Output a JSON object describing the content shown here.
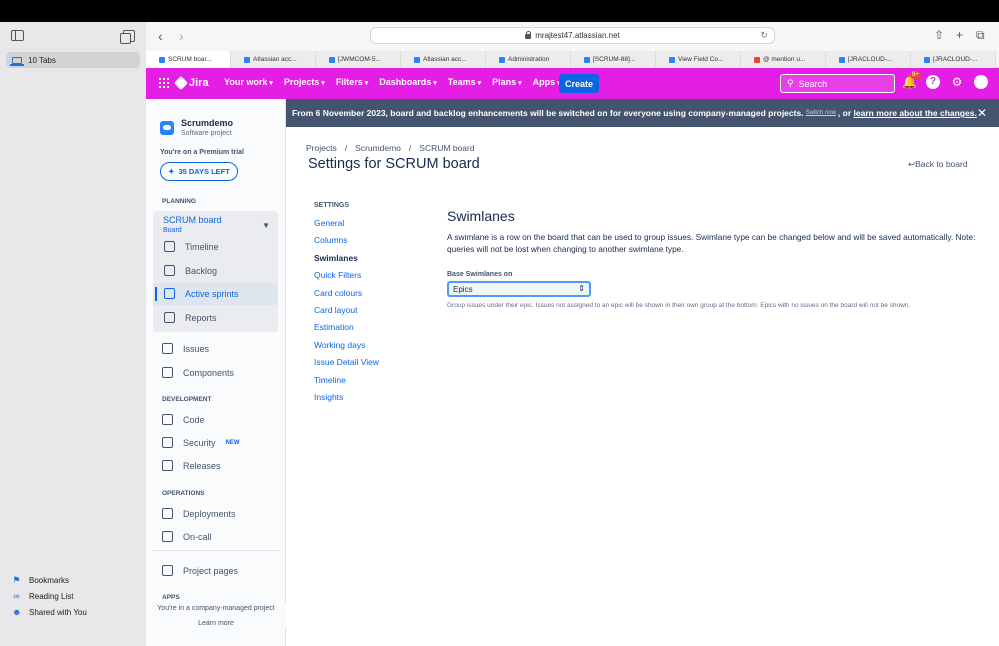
{
  "browser": {
    "sidebar": {
      "tab_group_label": "10 Tabs",
      "links": [
        {
          "label": "Bookmarks",
          "icon": "bookmark-icon"
        },
        {
          "label": "Reading List",
          "icon": "glasses-icon"
        },
        {
          "label": "Shared with You",
          "icon": "people-icon"
        }
      ]
    },
    "url": "mrajtest47.atlassian.net",
    "tabs": [
      {
        "label": "SCRUM boar...",
        "color": "#2684ff"
      },
      {
        "label": "Atlassian acc...",
        "color": "#2684ff"
      },
      {
        "label": "[JWMCOM-5...",
        "color": "#2684ff"
      },
      {
        "label": "Atlassian acc...",
        "color": "#2684ff"
      },
      {
        "label": "Administration",
        "color": "#2684ff"
      },
      {
        "label": "[SCRUM-88]...",
        "color": "#2684ff"
      },
      {
        "label": "View Field Co...",
        "color": "#2684ff"
      },
      {
        "label": "@ mention u...",
        "color": "#ea4335"
      },
      {
        "label": "[JRACLOUD-...",
        "color": "#2684ff"
      },
      {
        "label": "[JRACLOUD-...",
        "color": "#2684ff"
      }
    ]
  },
  "jira": {
    "logo": "Jira",
    "menu": [
      "Your work",
      "Projects",
      "Filters",
      "Dashboards",
      "Teams",
      "Plans",
      "Apps"
    ],
    "create_label": "Create",
    "search_placeholder": "Search",
    "notif_badge": "9+",
    "accent": "#e41ee4"
  },
  "project_sidebar": {
    "name": "Scrumdemo",
    "type": "Software project",
    "trial_text": "You're on a Premium trial",
    "trial_button": "35 DAYS LEFT",
    "planning_label": "PLANNING",
    "board_name": "SCRUM board",
    "board_sub": "Board",
    "board_items": [
      "Timeline",
      "Backlog",
      "Active sprints",
      "Reports"
    ],
    "other_items": [
      "Issues",
      "Components"
    ],
    "development_label": "DEVELOPMENT",
    "dev_items": [
      "Code",
      "Security",
      "Releases"
    ],
    "security_badge": "NEW",
    "operations_label": "OPERATIONS",
    "ops_items": [
      "Deployments",
      "On-call"
    ],
    "project_pages": "Project pages",
    "apps_label": "APPS",
    "footer_text": "You're in a company-managed project",
    "learn_more": "Learn more"
  },
  "banner": {
    "text": "From 6 November 2023, board and backlog enhancements will be switched on for everyone using company-managed projects.",
    "switch_now": "Switch now",
    "sep": ", or",
    "learn_more": "learn more about the changes."
  },
  "main": {
    "breadcrumb": [
      "Projects",
      "Scrumdemo",
      "SCRUM board"
    ],
    "title": "Settings for SCRUM board",
    "back_label": "Back to board",
    "settings_label": "SETTINGS",
    "settings_nav": [
      "General",
      "Columns",
      "Swimlanes",
      "Quick Filters",
      "Card colours",
      "Card layout",
      "Estimation",
      "Working days",
      "Issue Detail View",
      "Timeline",
      "Insights"
    ],
    "current_section": "Swimlanes",
    "section_title": "Swimlanes",
    "description": "A swimlane is a row on the board that can be used to group issues. Swimlane type can be changed below and will be saved automatically. Note: queries will not be lost when changing to another swimlane type.",
    "base_label": "Base Swimlanes on",
    "selected_value": "Epics",
    "help_text": "Group issues under their epic. Issues not assigned to an epic will be shown in their own group at the bottom. Epics with no issues on the board will not be shown."
  }
}
